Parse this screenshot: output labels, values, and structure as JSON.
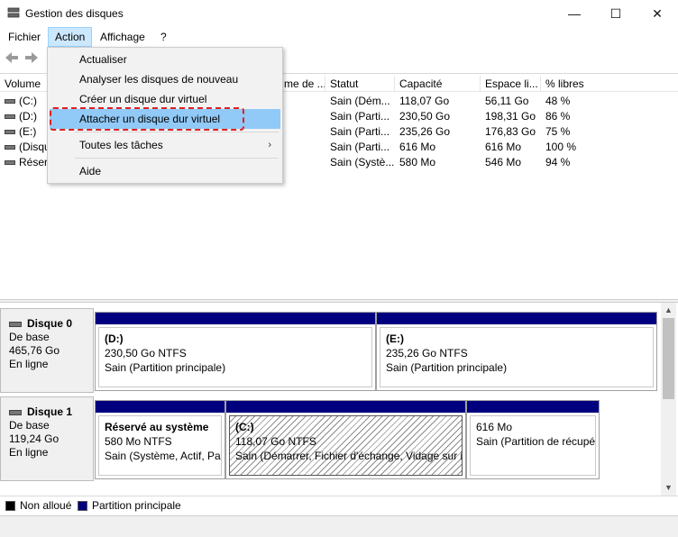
{
  "window": {
    "title": "Gestion des disques",
    "minimize": "—",
    "maximize": "☐",
    "close": "✕"
  },
  "menubar": {
    "items": [
      "Fichier",
      "Action",
      "Affichage",
      "?"
    ],
    "active": "Action"
  },
  "toolbar": {
    "back_icon": "arrow-left-icon",
    "forward_icon": "arrow-right-icon"
  },
  "table": {
    "columns": [
      "Volume",
      "me de ...",
      "Statut",
      "Capacité",
      "Espace li...",
      "% libres"
    ],
    "rows": [
      {
        "volume": "(C:)",
        "status": "Sain (Dém...",
        "capacity": "118,07 Go",
        "free": "56,11 Go",
        "pct": "48 %"
      },
      {
        "volume": "(D:)",
        "status": "Sain (Parti...",
        "capacity": "230,50 Go",
        "free": "198,31 Go",
        "pct": "86 %"
      },
      {
        "volume": "(E:)",
        "status": "Sain (Parti...",
        "capacity": "235,26 Go",
        "free": "176,83 Go",
        "pct": "75 %"
      },
      {
        "volume": "(Disqu",
        "status": "Sain (Parti...",
        "capacity": "616 Mo",
        "free": "616 Mo",
        "pct": "100 %"
      },
      {
        "volume": "Réserv",
        "status": "Sain (Systè...",
        "capacity": "580 Mo",
        "free": "546 Mo",
        "pct": "94 %"
      }
    ]
  },
  "disks": [
    {
      "name": "Disque 0",
      "type": "De base",
      "size": "465,76 Go",
      "state": "En ligne",
      "partitions": [
        {
          "name": "(D:)",
          "size": "230,50 Go NTFS",
          "status": "Sain (Partition principale)"
        },
        {
          "name": "(E:)",
          "size": "235,26 Go NTFS",
          "status": "Sain (Partition principale)"
        }
      ]
    },
    {
      "name": "Disque 1",
      "type": "De base",
      "size": "119,24 Go",
      "state": "En ligne",
      "partitions": [
        {
          "name": "Réservé au système",
          "size": "580 Mo NTFS",
          "status": "Sain (Système, Actif, Partition principale)"
        },
        {
          "name": "(C:)",
          "size": "118,07 Go NTFS",
          "status": "Sain (Démarrer, Fichier d'échange, Vidage sur incident, Partition principale)"
        },
        {
          "name": "",
          "size": "616 Mo",
          "status": "Sain (Partition de récupération)"
        }
      ]
    }
  ],
  "legend": [
    {
      "label": "Non alloué",
      "color": "#000000"
    },
    {
      "label": "Partition principale",
      "color": "#00007f"
    }
  ],
  "action_menu": {
    "items": [
      "Actualiser",
      "Analyser les disques de nouveau",
      "Créer un disque dur virtuel",
      "Attacher un disque dur virtuel",
      "Toutes les tâches",
      "Aide"
    ],
    "highlighted": "Attacher un disque dur virtuel",
    "submenu_arrow": "›"
  },
  "colors": {
    "primary_partition": "#00007f",
    "menu_highlight": "#91c9f7",
    "annotation": "#e02020"
  }
}
